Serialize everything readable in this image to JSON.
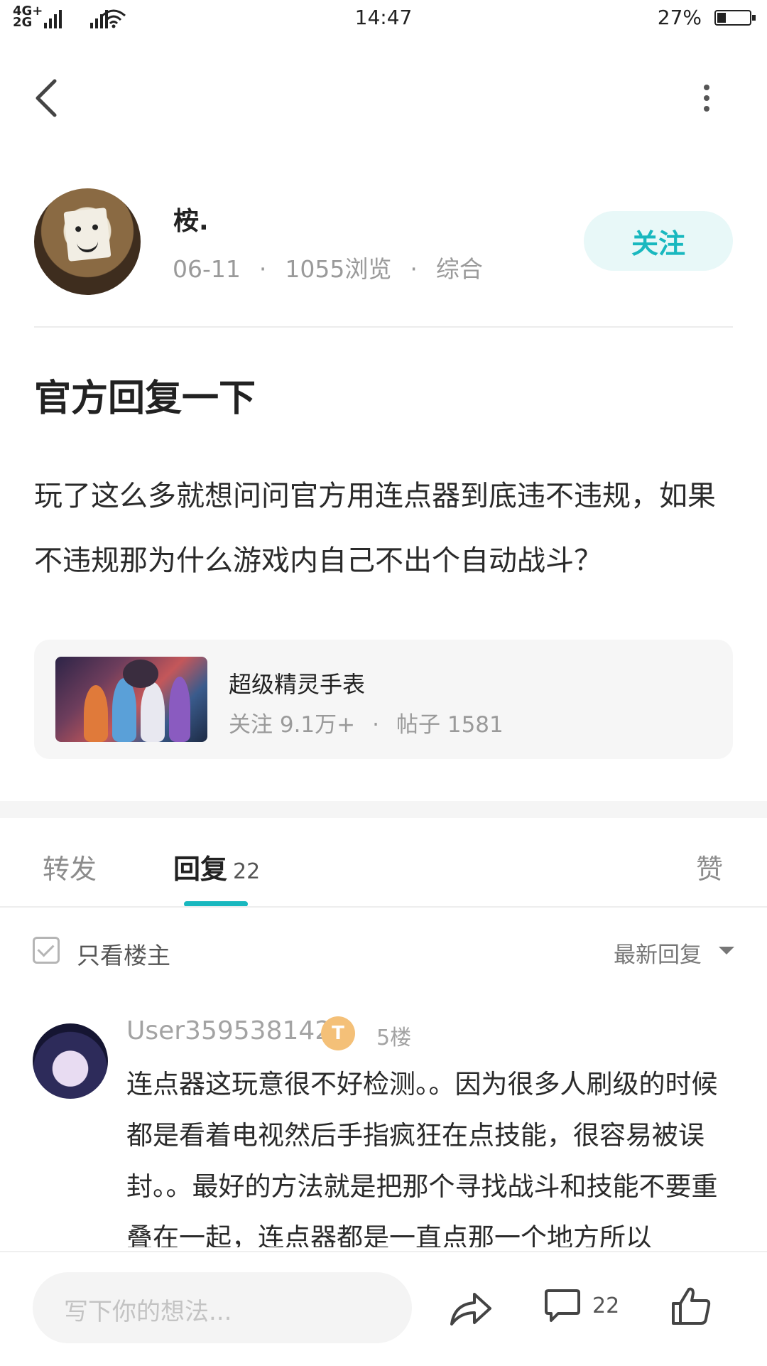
{
  "status_bar": {
    "network_left": "4G+",
    "network_right": "2G",
    "time": "14:47",
    "battery_percent": "27%"
  },
  "author": {
    "name": "桉.",
    "date": "06-11",
    "views": "1055浏览",
    "category": "综合",
    "follow_label": "关注"
  },
  "post": {
    "title": "官方回复一下",
    "body": "玩了这么多就想问问官方用连点器到底违不违规，如果不违规那为什么游戏内自己不出个自动战斗？"
  },
  "circle_card": {
    "name": "超级精灵手表",
    "followers": "关注 9.1万+",
    "posts": "帖子 1581"
  },
  "tabs": {
    "forward": "转发",
    "reply": "回复",
    "reply_count": "22",
    "like": "赞"
  },
  "filter": {
    "only_op_label": "只看楼主",
    "sort_label": "最新回复"
  },
  "comments": [
    {
      "user": "User359538142",
      "badge": "T",
      "floor": "5楼",
      "text": "连点器这玩意很不好检测。。因为很多人刷级的时候都是看着电视然后手指疯狂在点技能，很容易被误封。。最好的方法就是把那个寻找战斗和技能不要重叠在一起，连点器都是一直点那一个地方所以"
    }
  ],
  "bottom_bar": {
    "input_placeholder": "写下你的想法...",
    "comment_count": "22"
  },
  "icons": {
    "back": "back-arrow-icon",
    "more": "more-vertical-icon",
    "share": "share-icon",
    "comment": "comment-icon",
    "like": "thumbs-up-icon"
  },
  "colors": {
    "accent": "#19b8bf",
    "follow_bg": "#e8f8f8",
    "badge": "#f4c078"
  }
}
